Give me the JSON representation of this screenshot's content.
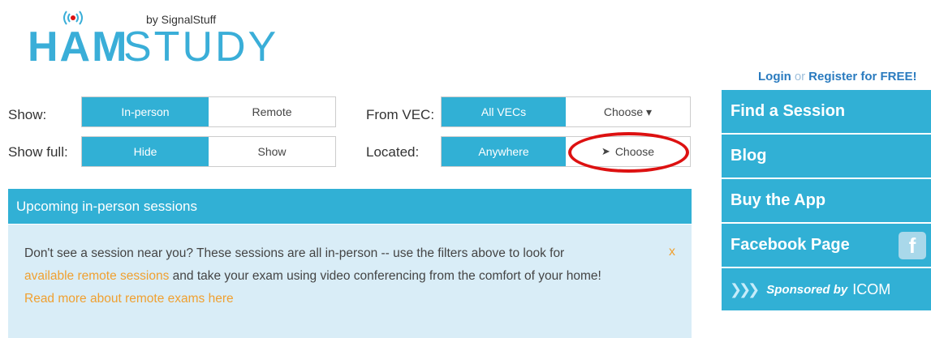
{
  "logo": {
    "ham": "HAM",
    "study": "STUDY",
    "by": "by SignalStuff"
  },
  "filters": {
    "show": {
      "label": "Show:",
      "options": [
        "In-person",
        "Remote"
      ],
      "active": "In-person"
    },
    "show_full": {
      "label": "Show full:",
      "options": [
        "Hide",
        "Show"
      ],
      "active": "Hide"
    },
    "from_vec": {
      "label": "From VEC:",
      "options": [
        "All VECs",
        "Choose ▾"
      ],
      "active": "All VECs"
    },
    "located": {
      "label": "Located:",
      "options": [
        "Anywhere",
        "Choose"
      ],
      "active": "Anywhere"
    }
  },
  "panel": {
    "title": "Upcoming in-person sessions"
  },
  "alert": {
    "text_before": "Don't see a session near you? These sessions are all in-person -- use the filters above to look for",
    "link": "available remote sessions",
    "text_after": " and take your exam using video conferencing from the comfort of your home!",
    "read_more": "Read more about remote exams here",
    "close": "x"
  },
  "account": {
    "login": "Login",
    "or": "or",
    "register": "Register for FREE!"
  },
  "sidenav": {
    "items": [
      "Find a Session",
      "Blog",
      "Buy the App",
      "Facebook Page"
    ],
    "sponsor_text": "Sponsored by",
    "sponsor_brand": "ICOM"
  },
  "colors": {
    "brand": "#31b0d5",
    "alert_bg": "#d9edf7",
    "link": "#f0a030",
    "highlight": "#dd1111"
  }
}
